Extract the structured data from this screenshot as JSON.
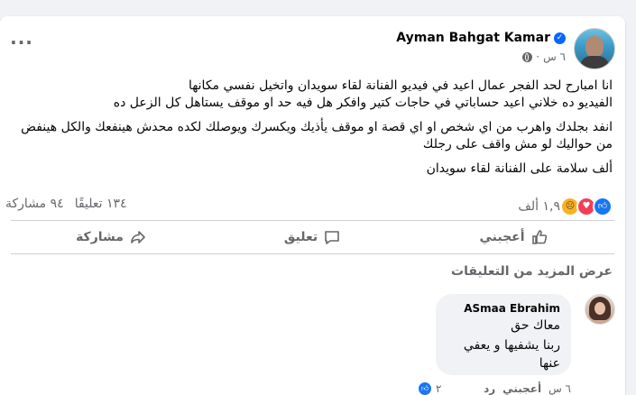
{
  "post": {
    "author": "Ayman Bahgat Kamar",
    "time": "٦ س",
    "separator": "·",
    "text_lines": [
      "انا امبارح لحد الفجر عمال اعيد في فيديو الفنانة لقاء سويدان واتخيل نفسي مكانها\nالفيديو ده خلاني اعيد حساباتي في حاجات كتير وافكر هل فيه حد او موقف يستاهل كل الزعل ده",
      "انفد بجلدك واهرب من اي شخص او اي قصة او موقف يأذيك ويكسرك ويوصلك لكده محدش هينفعك والكل هينفض من حواليك لو مش واقف على رجلك",
      "ألف سلامة على الفنانة لقاء سويدان"
    ]
  },
  "stats": {
    "reactions_count": "١,٩ ألف",
    "comments": "١٣٤ تعليقًا",
    "shares": "٩٤ مشاركة",
    "reaction_icons": [
      "like",
      "love",
      "sad"
    ]
  },
  "actions": {
    "like": "أعجبني",
    "comment": "تعليق",
    "share": "مشاركة"
  },
  "more_comments": "عرض المزيد من التعليقات",
  "comment": {
    "author": "ASmaa Ebrahim",
    "lines": [
      "معاك حق",
      "ربنا يشفيها و يعفي عنها"
    ],
    "time": "٦ س",
    "like": "أعجبني",
    "reply": "رد",
    "reaction_count": "٢"
  },
  "colors": {
    "accent": "#1877f2",
    "verified": "#0866ff",
    "muted_text": "#65676b",
    "background": "#f0f2f5"
  }
}
